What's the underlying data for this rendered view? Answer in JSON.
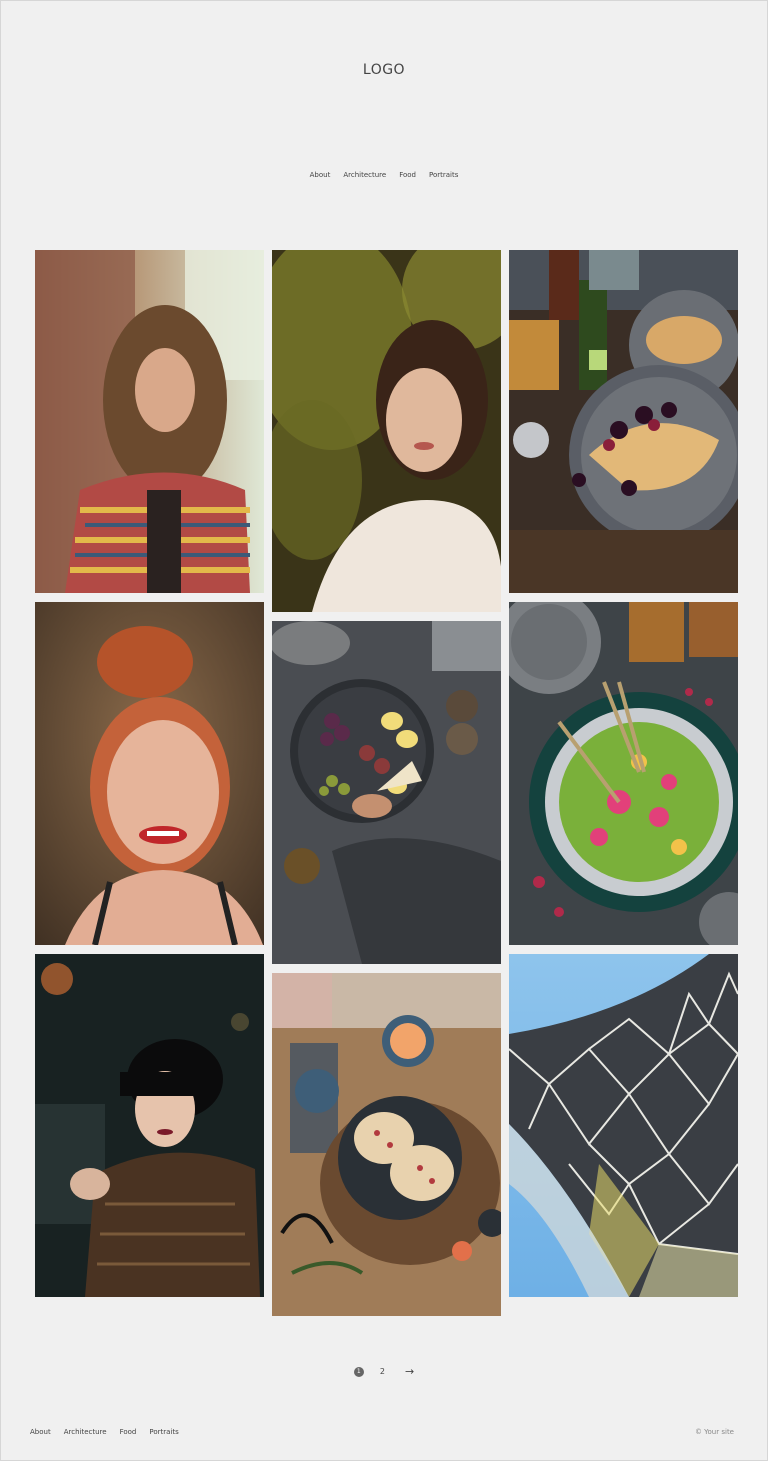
{
  "header": {
    "logo": "LOGO",
    "nav": [
      "About",
      "Architecture",
      "Food",
      "Portraits"
    ]
  },
  "gallery": {
    "columns": [
      [
        {
          "name": "portrait-curly-hair",
          "category": "Portraits"
        },
        {
          "name": "portrait-red-hair-smile",
          "category": "Portraits"
        },
        {
          "name": "portrait-short-black-hair",
          "category": "Portraits"
        }
      ],
      [
        {
          "name": "portrait-sunlit-leaves",
          "category": "Portraits"
        },
        {
          "name": "food-figs-platter",
          "category": "Food"
        },
        {
          "name": "food-pancakes-table",
          "category": "Food"
        }
      ],
      [
        {
          "name": "food-waffles-berries",
          "category": "Food"
        },
        {
          "name": "food-green-bowl",
          "category": "Food"
        },
        {
          "name": "architecture-facade",
          "category": "Architecture"
        }
      ]
    ]
  },
  "pagination": {
    "current": "1",
    "next_page": "2",
    "arrow": "→"
  },
  "footer": {
    "nav": [
      "About",
      "Architecture",
      "Food",
      "Portraits"
    ],
    "copyright": "© Your site"
  },
  "colors": {
    "background": "#f0f0f0",
    "text": "#444444"
  }
}
